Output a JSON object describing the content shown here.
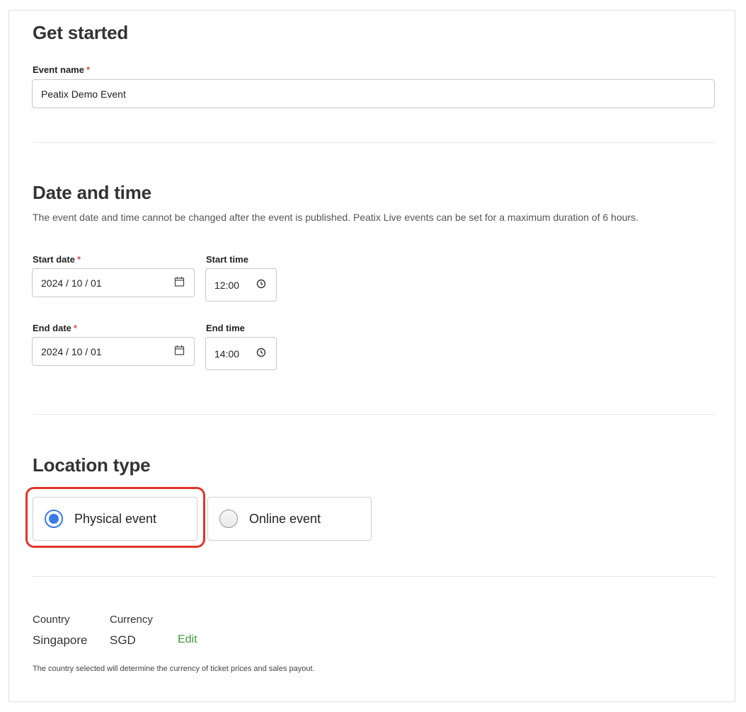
{
  "sections": {
    "get_started": {
      "title": "Get started",
      "event_name_label": "Event name",
      "required_mark": "*",
      "event_name_value": "Peatix Demo Event"
    },
    "date_time": {
      "title": "Date and time",
      "description": "The event date and time cannot be changed after the event is published. Peatix Live events can be set for a maximum duration of 6 hours.",
      "start_date_label": "Start date",
      "start_date_value": "2024 / 10 / 01",
      "start_time_label": "Start time",
      "start_time_value": "12:00",
      "end_date_label": "End date",
      "end_date_value": "2024 / 10 / 01",
      "end_time_label": "End time",
      "end_time_value": "14:00",
      "required_mark": "*"
    },
    "location_type": {
      "title": "Location type",
      "options": [
        {
          "label": "Physical event",
          "selected": true
        },
        {
          "label": "Online event",
          "selected": false
        }
      ]
    },
    "region": {
      "country_label": "Country",
      "country_value": "Singapore",
      "currency_label": "Currency",
      "currency_value": "SGD",
      "edit_label": "Edit",
      "footnote": "The country selected will determine the currency of ticket prices and sales payout."
    }
  },
  "colors": {
    "accent_blue": "#3b7be8",
    "highlight_red": "#e0352b",
    "required_red": "#d9534f",
    "link_green": "#3e9a3e"
  },
  "icons": {
    "date_picker": "calendar-icon",
    "time_picker": "clock-icon"
  }
}
